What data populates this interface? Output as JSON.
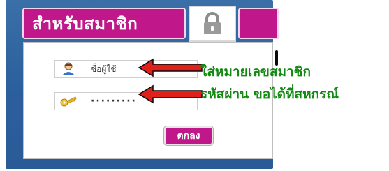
{
  "login": {
    "member_tab_label": "สำหรับสมาชิก",
    "username_placeholder": "ชื่อผู้ใช้",
    "password_mask": "·········",
    "ok_label": "ตกลง"
  },
  "annotations": {
    "username_hint": "ใส่หมายเลขสมาชิก",
    "password_hint": "รหัสผ่าน ขอได้ที่สหกรณ์"
  },
  "icons": {
    "lock": "lock-icon",
    "user": "user-icon",
    "key": "key-icon",
    "arrow": "arrow-left-icon"
  },
  "colors": {
    "panel_blue": "#2b5f9c",
    "accent_magenta": "#c0178a",
    "hint_green": "#128a12",
    "arrow_red": "#e0201a"
  }
}
